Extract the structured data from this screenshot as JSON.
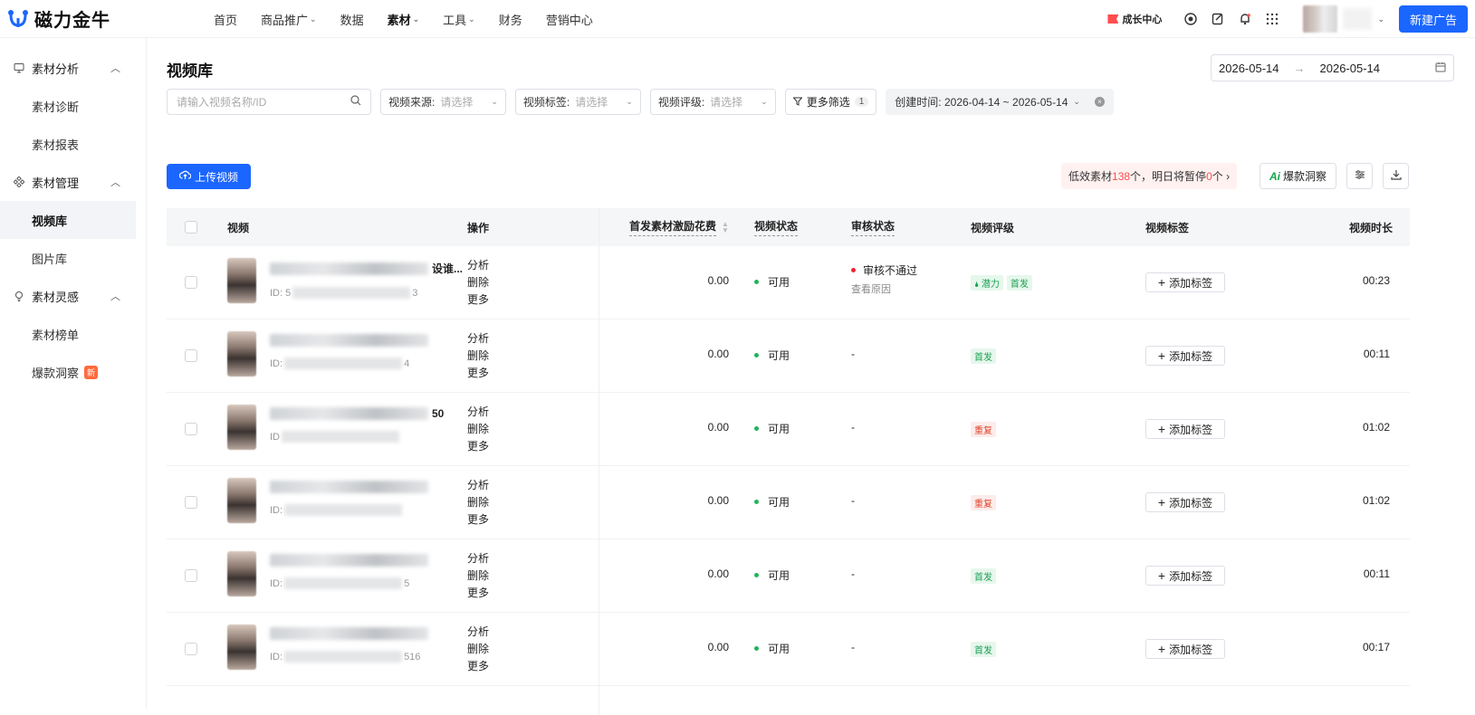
{
  "brand": {
    "name": "磁力金牛"
  },
  "nav": [
    {
      "label": "首页",
      "chevron": false,
      "active": false
    },
    {
      "label": "商品推广",
      "chevron": true,
      "active": false
    },
    {
      "label": "数据",
      "chevron": false,
      "active": false
    },
    {
      "label": "素材",
      "chevron": true,
      "active": true
    },
    {
      "label": "工具",
      "chevron": true,
      "active": false
    },
    {
      "label": "财务",
      "chevron": false,
      "active": false
    },
    {
      "label": "营销中心",
      "chevron": false,
      "active": false
    }
  ],
  "topRight": {
    "growth": "成长中心",
    "newAd": "新建广告"
  },
  "sidebar": {
    "groups": [
      {
        "label": "素材分析",
        "icon": "monitor-icon",
        "items": [
          {
            "label": "素材诊断",
            "active": false,
            "badge": ""
          },
          {
            "label": "素材报表",
            "active": false,
            "badge": ""
          }
        ]
      },
      {
        "label": "素材管理",
        "icon": "diamond-grid-icon",
        "items": [
          {
            "label": "视频库",
            "active": true,
            "badge": ""
          },
          {
            "label": "图片库",
            "active": false,
            "badge": ""
          }
        ]
      },
      {
        "label": "素材灵感",
        "icon": "bulb-icon",
        "items": [
          {
            "label": "素材榜单",
            "active": false,
            "badge": ""
          },
          {
            "label": "爆款洞察",
            "active": false,
            "badge": "新"
          }
        ]
      }
    ]
  },
  "page": {
    "title": "视频库",
    "dateStart": "2026-05-14",
    "dateEnd": "2026-05-14",
    "dateArrow": "→"
  },
  "filters": {
    "searchPlaceholder": "请输入视频名称/ID",
    "source": {
      "label": "视频来源:",
      "placeholder": "请选择"
    },
    "tags": {
      "label": "视频标签:",
      "placeholder": "请选择"
    },
    "rating": {
      "label": "视频评级:",
      "placeholder": "请选择"
    },
    "more": {
      "label": "更多筛选",
      "count": "1"
    },
    "createdTime": "创建时间: 2026-04-14 ~ 2026-05-14"
  },
  "toolbar": {
    "upload": "上传视频",
    "lowPrefix": "低效素材",
    "lowCount": "138",
    "lowMid": "个，明日将暂停",
    "pauseCount": "0",
    "lowSuffix": "个 ›",
    "insightAi": "Ai",
    "insight": "爆款洞察"
  },
  "table": {
    "headers": {
      "video": "视频",
      "ops": "操作",
      "spend": "首发素材激励花费",
      "status": "视频状态",
      "review": "审核状态",
      "rating": "视频评级",
      "tags": "视频标签",
      "duration": "视频时长"
    },
    "rows": [
      {
        "titleTail": "设谁...",
        "idPrefix": "ID: 5",
        "idTail": "3",
        "ops": [
          "分析",
          "删除",
          "更多"
        ],
        "spend": "0.00",
        "status": "可用",
        "review": "审核不通过",
        "reviewSub": "查看原因",
        "reviewError": true,
        "ratings": [
          {
            "text": "潜力",
            "color": "green",
            "icon": "drop-icon"
          },
          {
            "text": "首发",
            "color": "green",
            "icon": ""
          }
        ],
        "addTag": "添加标签",
        "duration": "00:23"
      },
      {
        "titleTail": "",
        "idPrefix": "ID:",
        "idTail": "4",
        "ops": [
          "分析",
          "删除",
          "更多"
        ],
        "spend": "0.00",
        "status": "可用",
        "review": "-",
        "reviewSub": "",
        "reviewError": false,
        "ratings": [
          {
            "text": "首发",
            "color": "green",
            "icon": ""
          }
        ],
        "addTag": "添加标签",
        "duration": "00:11"
      },
      {
        "titleTail": "50",
        "idPrefix": "ID",
        "idTail": "",
        "ops": [
          "分析",
          "删除",
          "更多"
        ],
        "spend": "0.00",
        "status": "可用",
        "review": "-",
        "reviewSub": "",
        "reviewError": false,
        "ratings": [
          {
            "text": "重复",
            "color": "red",
            "icon": ""
          }
        ],
        "addTag": "添加标签",
        "duration": "01:02"
      },
      {
        "titleTail": "",
        "idPrefix": "ID:",
        "idTail": "",
        "ops": [
          "分析",
          "删除",
          "更多"
        ],
        "spend": "0.00",
        "status": "可用",
        "review": "-",
        "reviewSub": "",
        "reviewError": false,
        "ratings": [
          {
            "text": "重复",
            "color": "red",
            "icon": ""
          }
        ],
        "addTag": "添加标签",
        "duration": "01:02"
      },
      {
        "titleTail": "",
        "idPrefix": "ID:",
        "idTail": "5",
        "ops": [
          "分析",
          "删除",
          "更多"
        ],
        "spend": "0.00",
        "status": "可用",
        "review": "-",
        "reviewSub": "",
        "reviewError": false,
        "ratings": [
          {
            "text": "首发",
            "color": "green",
            "icon": ""
          }
        ],
        "addTag": "添加标签",
        "duration": "00:11"
      },
      {
        "titleTail": "",
        "idPrefix": "ID:",
        "idTail": "516",
        "ops": [
          "分析",
          "删除",
          "更多"
        ],
        "spend": "0.00",
        "status": "可用",
        "review": "-",
        "reviewSub": "",
        "reviewError": false,
        "ratings": [
          {
            "text": "首发",
            "color": "green",
            "icon": ""
          }
        ],
        "addTag": "添加标签",
        "duration": "00:17"
      }
    ]
  },
  "colors": {
    "primary": "#1b66ff",
    "green": "#22b35e",
    "red": "#f5222d"
  }
}
